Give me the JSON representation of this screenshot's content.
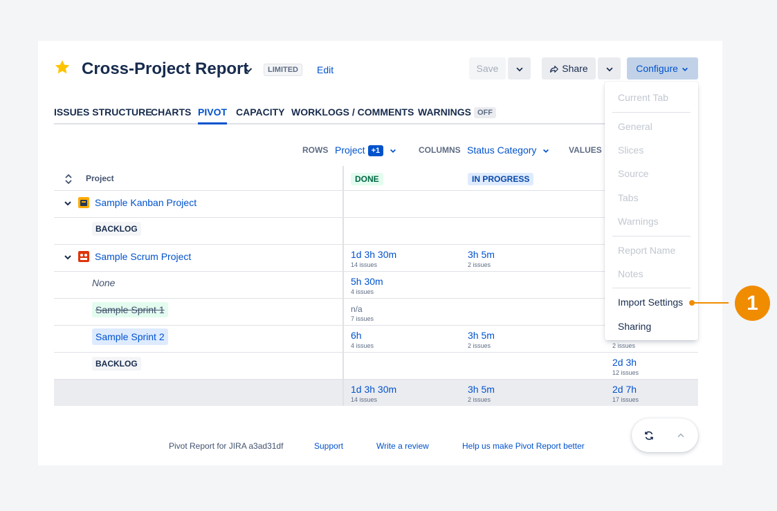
{
  "header": {
    "title": "Cross-Project Report",
    "badge": "LIMITED",
    "edit_label": "Edit",
    "save_label": "Save",
    "share_label": "Share",
    "configure_label": "Configure"
  },
  "tabs": [
    {
      "label": "ISSUES STRUCTURE"
    },
    {
      "label": "CHARTS"
    },
    {
      "label": "PIVOT",
      "active": true
    },
    {
      "label": "CAPACITY"
    },
    {
      "label": "WORKLOGS / COMMENTS"
    },
    {
      "label": "WARNINGS",
      "badge": "OFF"
    }
  ],
  "toolbar": {
    "rows_label": "ROWS",
    "rows_value": "Project",
    "rows_badge": "+1",
    "columns_label": "COLUMNS",
    "columns_value": "Status Category",
    "values_label": "VALUES"
  },
  "table": {
    "header_project": "Project",
    "columns": [
      "DONE",
      "IN PROGRESS"
    ],
    "rows": [
      {
        "label": "Sample Kanban Project",
        "type": "project"
      },
      {
        "label": "BACKLOG",
        "type": "tag"
      },
      {
        "label": "Sample Scrum Project",
        "type": "project",
        "done": "1d 3h 30m",
        "done_sub": "14 issues",
        "inprog": "3h 5m",
        "inprog_sub": "2 issues"
      },
      {
        "label": "None",
        "type": "none",
        "done": "5h 30m",
        "done_sub": "4 issues"
      },
      {
        "label": "Sample Sprint 1",
        "type": "sprint-done",
        "done": "n/a",
        "done_sub": "7 issues"
      },
      {
        "label": "Sample Sprint 2",
        "type": "sprint-active",
        "done": "6h",
        "done_sub": "4 issues",
        "inprog": "3h 5m",
        "inprog_sub": "2 issues",
        "third_sub": "2 issues"
      },
      {
        "label": "BACKLOG",
        "type": "tag",
        "third": "2d 3h",
        "third_sub": "12 issues"
      },
      {
        "type": "total",
        "done": "1d 3h 30m",
        "done_sub": "14 issues",
        "inprog": "3h 5m",
        "inprog_sub": "2 issues",
        "third": "2d 7h",
        "third_sub": "17 issues"
      }
    ]
  },
  "configure_menu": {
    "items": [
      {
        "label": "Current Tab",
        "enabled": false
      },
      {
        "label": "General",
        "enabled": false
      },
      {
        "label": "Slices",
        "enabled": false
      },
      {
        "label": "Source",
        "enabled": false
      },
      {
        "label": "Tabs",
        "enabled": false
      },
      {
        "label": "Warnings",
        "enabled": false
      },
      {
        "label": "Report Name",
        "enabled": false
      },
      {
        "label": "Notes",
        "enabled": false
      },
      {
        "label": "Import Settings",
        "enabled": true
      },
      {
        "label": "Sharing",
        "enabled": true
      }
    ]
  },
  "callout": {
    "number": "1",
    "color": "#f08c00"
  },
  "footer": {
    "version": "Pivot Report for JIRA a3ad31df",
    "support": "Support",
    "review": "Write a review",
    "feedback": "Help us make Pivot Report better"
  },
  "colors": {
    "accent": "#0052cc",
    "done_lozenge": "#e3fcef",
    "inprogress_lozenge": "#deebff",
    "star": "#ffc400"
  }
}
